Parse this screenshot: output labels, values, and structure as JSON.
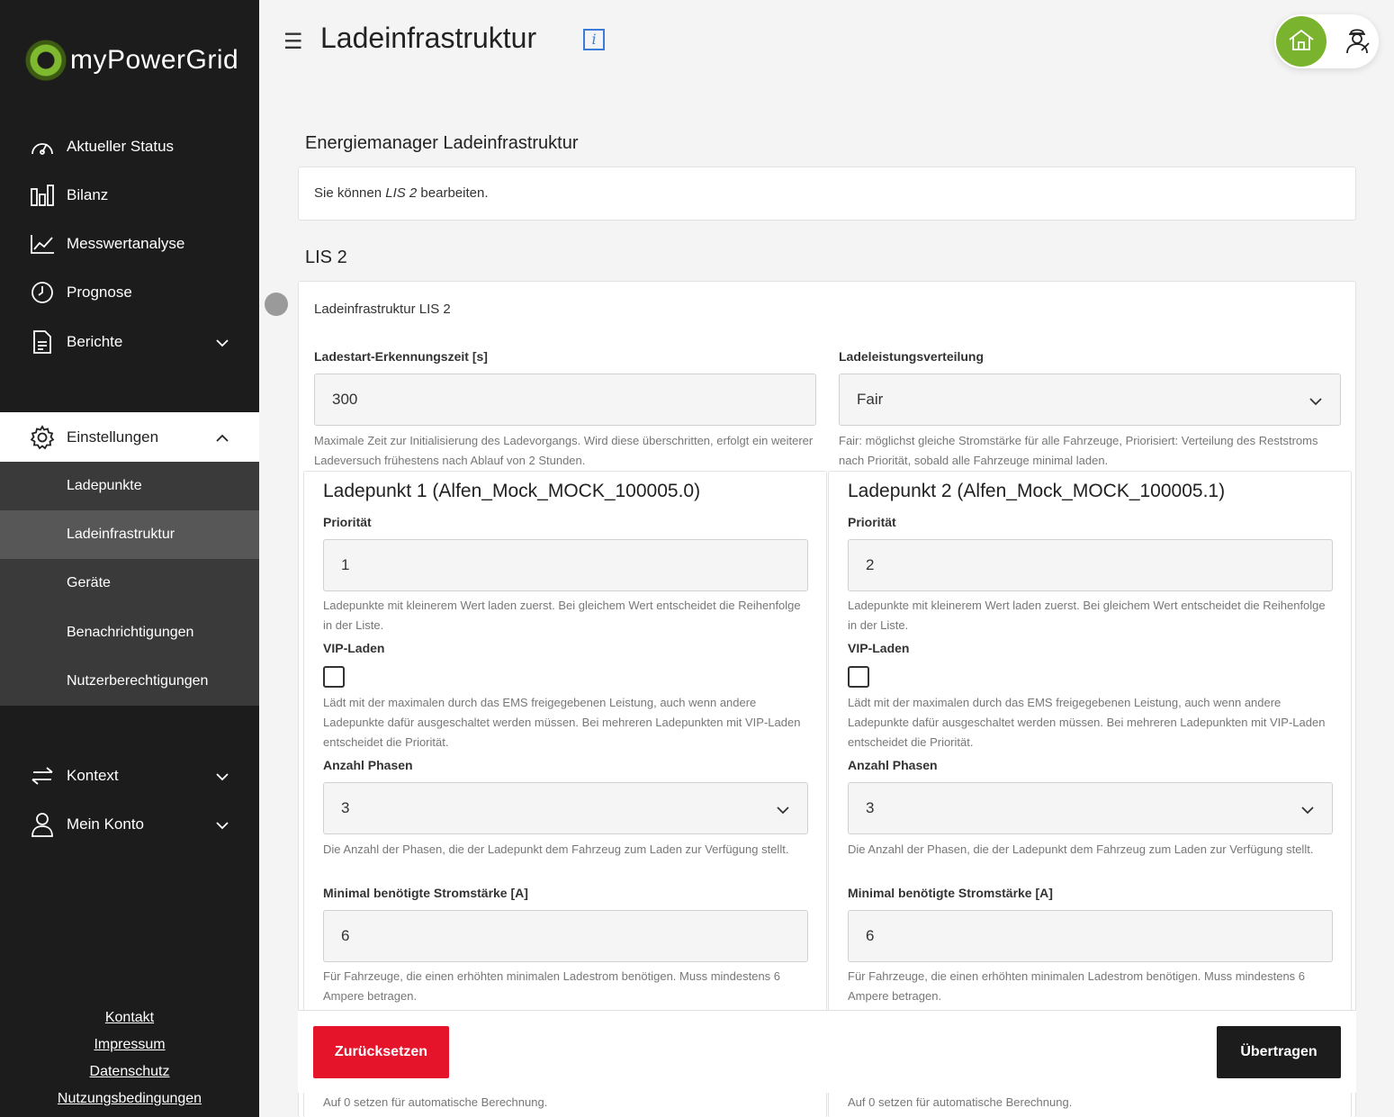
{
  "brand": {
    "name": "myPowerGrid"
  },
  "sidebar": {
    "items": [
      {
        "label": "Aktueller Status",
        "icon": "gauge-icon"
      },
      {
        "label": "Bilanz",
        "icon": "bar-chart-icon"
      },
      {
        "label": "Messwertanalyse",
        "icon": "line-chart-icon"
      },
      {
        "label": "Prognose",
        "icon": "clock-icon"
      },
      {
        "label": "Berichte",
        "icon": "document-icon"
      }
    ],
    "settings": {
      "label": "Einstellungen",
      "icon": "gear-icon"
    },
    "sub_items": [
      "Ladepunkte",
      "Ladeinfrastruktur",
      "Geräte",
      "Benachrichtigungen",
      "Nutzerberechtigungen"
    ],
    "bottom_items": [
      {
        "label": "Kontext",
        "icon": "swap-arrows-icon"
      },
      {
        "label": "Mein Konto",
        "icon": "user-icon"
      }
    ],
    "footer_links": [
      "Kontakt",
      "Impressum",
      "Datenschutz",
      "Nutzungsbedingungen"
    ]
  },
  "header": {
    "menu_glyph": "☰",
    "title": "Ladeinfrastruktur",
    "info_glyph": "i"
  },
  "energy_manager": {
    "title": "Energiemanager Ladeinfrastruktur",
    "notice_prefix": "Sie können ",
    "notice_em": "LIS 2",
    "notice_suffix": " bearbeiten."
  },
  "lis": {
    "section_title": "LIS 2",
    "card_title": "Ladeinfrastruktur LIS 2",
    "detect_label": "Ladestart-Erkennungszeit [s]",
    "detect_value": "300",
    "detect_hint": "Maximale Zeit zur Initialisierung des Ladevorgangs. Wird diese überschritten, erfolgt ein weiterer Ladeversuch frühestens nach Ablauf von 2 Stunden.",
    "dist_label": "Ladeleistungsverteilung",
    "dist_value": "Fair",
    "dist_hint": "Fair: möglichst gleiche Stromstärke für alle Fahrzeuge, Priorisiert: Verteilung des Reststroms nach Priorität, sobald alle Fahrzeuge minimal laden."
  },
  "ladepunkte": [
    {
      "title": "Ladepunkt 1 (Alfen_Mock_MOCK_100005.0)",
      "priority_label": "Priorität",
      "priority_value": "1",
      "priority_hint": "Ladepunkte mit kleinerem Wert laden zuerst. Bei gleichem Wert entscheidet die Reihenfolge in der Liste.",
      "vip_label": "VIP-Laden",
      "vip_hint": "Lädt mit der maximalen durch das EMS freigegebenen Leistung, auch wenn andere Ladepunkte dafür ausgeschaltet werden müssen. Bei mehreren Ladepunkten mit VIP-Laden entscheidet die Priorität.",
      "phases_label": "Anzahl Phasen",
      "phases_value": "3",
      "phases_hint": "Die Anzahl der Phasen, die der Ladepunkt dem Fahrzeug zum Laden zur Verfügung stellt.",
      "min_label": "Minimal benötigte Stromstärke [A]",
      "min_value": "6",
      "min_hint": "Für Fahrzeuge, die einen erhöhten minimalen Ladestrom benötigen. Muss mindestens 6 Ampere betragen.",
      "auto_hint": "Auf 0 setzen für automatische Berechnung."
    },
    {
      "title": "Ladepunkt 2 (Alfen_Mock_MOCK_100005.1)",
      "priority_label": "Priorität",
      "priority_value": "2",
      "priority_hint": "Ladepunkte mit kleinerem Wert laden zuerst. Bei gleichem Wert entscheidet die Reihenfolge in der Liste.",
      "vip_label": "VIP-Laden",
      "vip_hint": "Lädt mit der maximalen durch das EMS freigegebenen Leistung, auch wenn andere Ladepunkte dafür ausgeschaltet werden müssen. Bei mehreren Ladepunkten mit VIP-Laden entscheidet die Priorität.",
      "phases_label": "Anzahl Phasen",
      "phases_value": "3",
      "phases_hint": "Die Anzahl der Phasen, die der Ladepunkt dem Fahrzeug zum Laden zur Verfügung stellt.",
      "min_label": "Minimal benötigte Stromstärke [A]",
      "min_value": "6",
      "min_hint": "Für Fahrzeuge, die einen erhöhten minimalen Ladestrom benötigen. Muss mindestens 6 Ampere betragen.",
      "auto_hint": "Auf 0 setzen für automatische Berechnung."
    }
  ],
  "actions": {
    "reset_label": "Zurücksetzen",
    "submit_label": "Übertragen"
  },
  "colors": {
    "accent_green": "#7ab32e",
    "danger_red": "#e5142b",
    "sidebar_bg": "#1c1c1c"
  }
}
